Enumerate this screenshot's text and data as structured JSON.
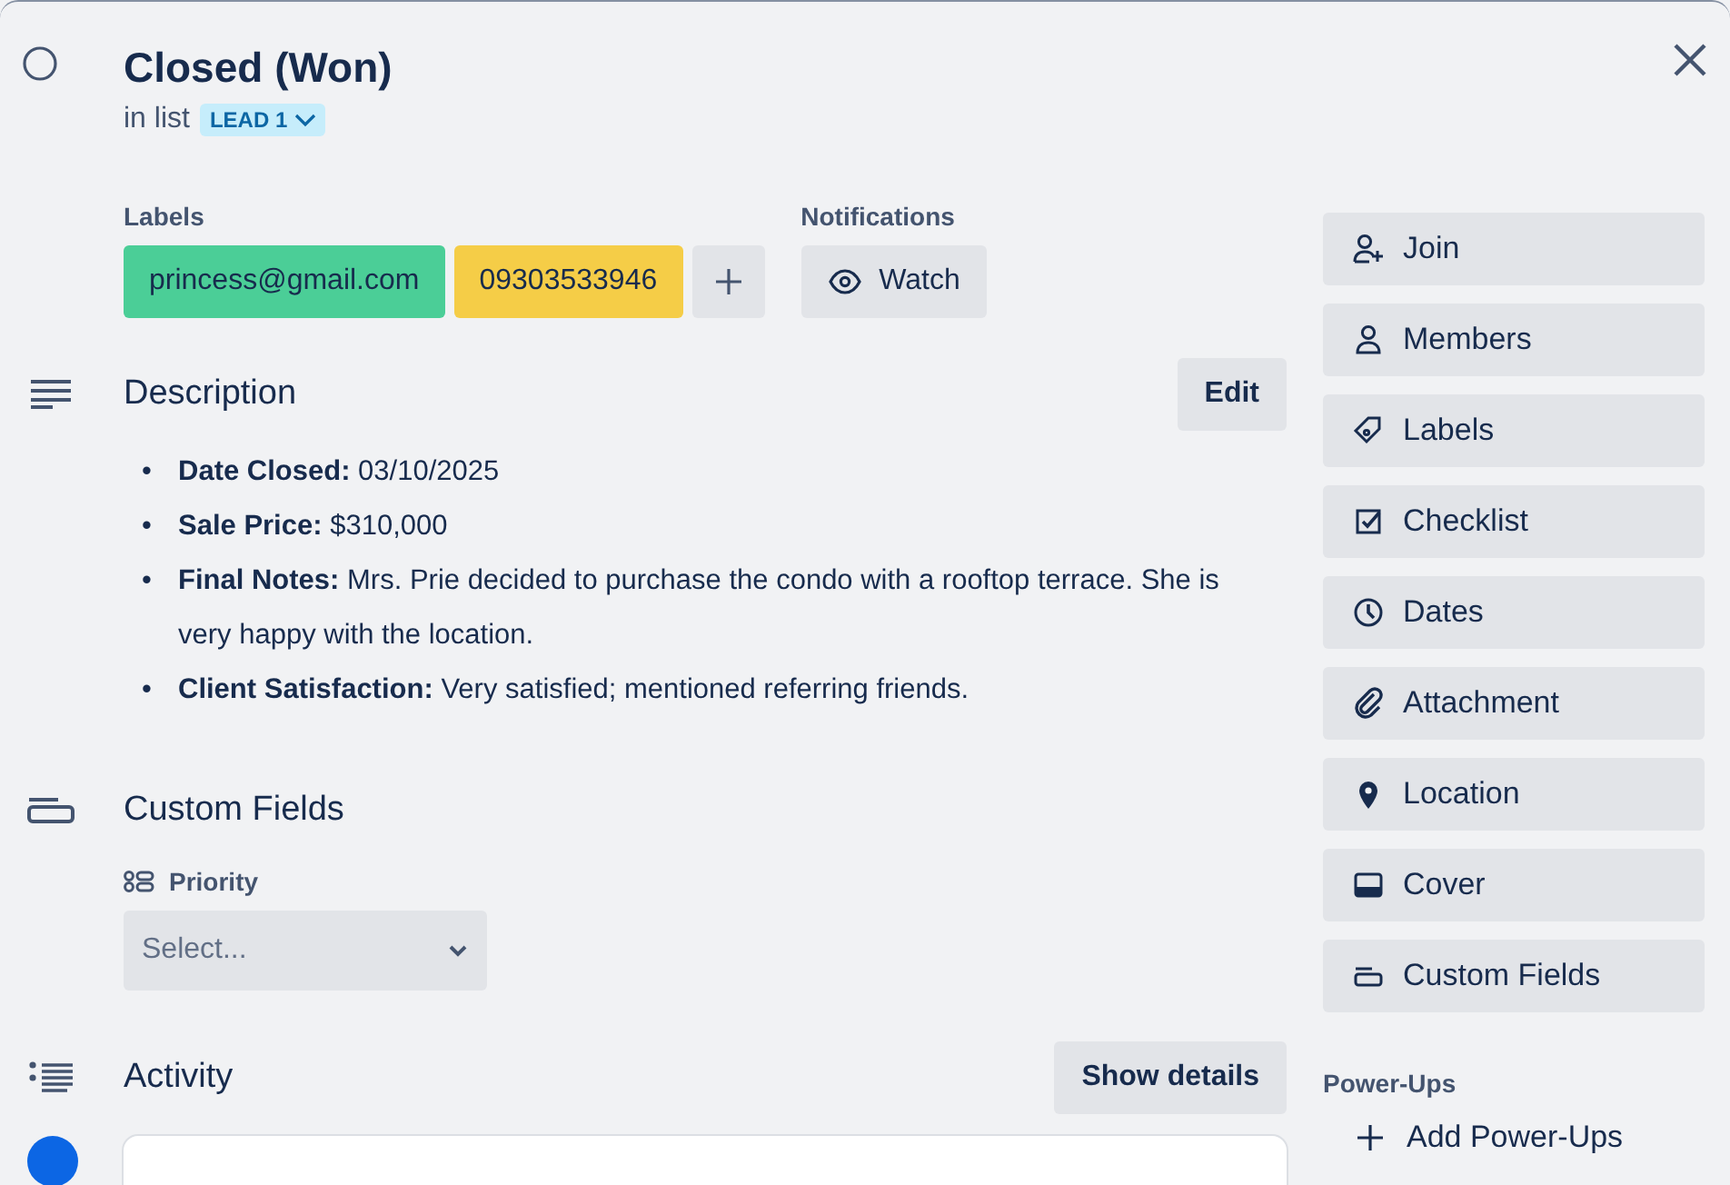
{
  "card": {
    "title": "Closed (Won)",
    "completed": false,
    "list_prefix": "in list",
    "list_name": "LEAD 1"
  },
  "labels": {
    "heading": "Labels",
    "items": [
      {
        "text": "princess@gmail.com",
        "color": "#4bce97"
      },
      {
        "text": "09303533946",
        "color": "#f5cd47"
      }
    ]
  },
  "notifications": {
    "heading": "Notifications",
    "button": "Watch"
  },
  "description": {
    "heading": "Description",
    "edit_button": "Edit",
    "marker": "•",
    "items": [
      "**Date Closed:** 03/10/2025",
      "**Sale Price:** $310,000",
      "**Final Notes:** Mrs. Prie decided to purchase the condo with a rooftop terrace. She is very happy with the location.",
      "**Client Satisfaction:** Very satisfied; mentioned referring friends."
    ]
  },
  "custom_fields": {
    "heading": "Custom Fields",
    "fields": [
      {
        "label": "Priority",
        "placeholder": "Select..."
      }
    ]
  },
  "activity": {
    "heading": "Activity",
    "button": "Show details"
  },
  "sidebar": {
    "actions": [
      {
        "kind": "join",
        "label": "Join"
      },
      {
        "kind": "members",
        "label": "Members"
      },
      {
        "kind": "labels",
        "label": "Labels"
      },
      {
        "kind": "checklist",
        "label": "Checklist"
      },
      {
        "kind": "dates",
        "label": "Dates"
      },
      {
        "kind": "attachment",
        "label": "Attachment"
      },
      {
        "kind": "location",
        "label": "Location"
      },
      {
        "kind": "cover",
        "label": "Cover"
      },
      {
        "kind": "custom_fields",
        "label": "Custom Fields"
      }
    ],
    "powerups_heading": "Power-Ups",
    "add_powerups": "Add Power-Ups"
  }
}
